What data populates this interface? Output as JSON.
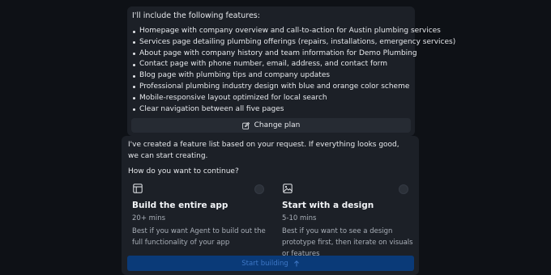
{
  "plan": {
    "intro": "I'll include the following features:",
    "features": [
      "Homepage with company overview and call-to-action for Austin plumbing services",
      "Services page detailing plumbing offerings (repairs, installations, emergency services)",
      "About page with company history and team information for Demo Plumbing",
      "Contact page with phone number, email, address, and contact form",
      "Blog page with plumbing tips and company updates",
      "Professional plumbing industry design with blue and orange color scheme",
      "Mobile-responsive layout optimized for local search",
      "Clear navigation between all five pages"
    ],
    "change_plan_label": "Change plan"
  },
  "message": {
    "text": "I've created a feature list based on your request. If everything looks good, we can start creating.",
    "question": "How do you want to continue?"
  },
  "options": [
    {
      "title": "Build the entire app",
      "time": "20+ mins",
      "description": "Best if you want Agent to build out the full functionality of your app",
      "icon": "layout-icon"
    },
    {
      "title": "Start with a design",
      "time": "5-10 mins",
      "description": "Best if you want to see a design prototype first, then iterate on visuals or features",
      "icon": "image-icon"
    }
  ],
  "start_button": {
    "label": "Start building",
    "icon": "arrow-up-icon"
  }
}
